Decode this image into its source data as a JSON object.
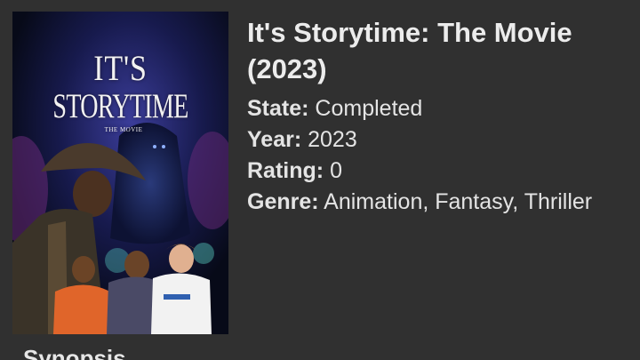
{
  "movie": {
    "poster": {
      "line1": "IT'S",
      "line2": "STORYTIME",
      "line3": "THE MOVIE"
    },
    "title": "It's Storytime: The Movie (2023)",
    "fields": [
      {
        "key": "State:",
        "value": "Completed"
      },
      {
        "key": "Year:",
        "value": "2023"
      },
      {
        "key": "Rating:",
        "value": "0"
      },
      {
        "key": "Genre:",
        "value": "Animation, Fantasy, Thriller"
      }
    ]
  },
  "section": {
    "synopsis_heading": "Synopsis"
  }
}
